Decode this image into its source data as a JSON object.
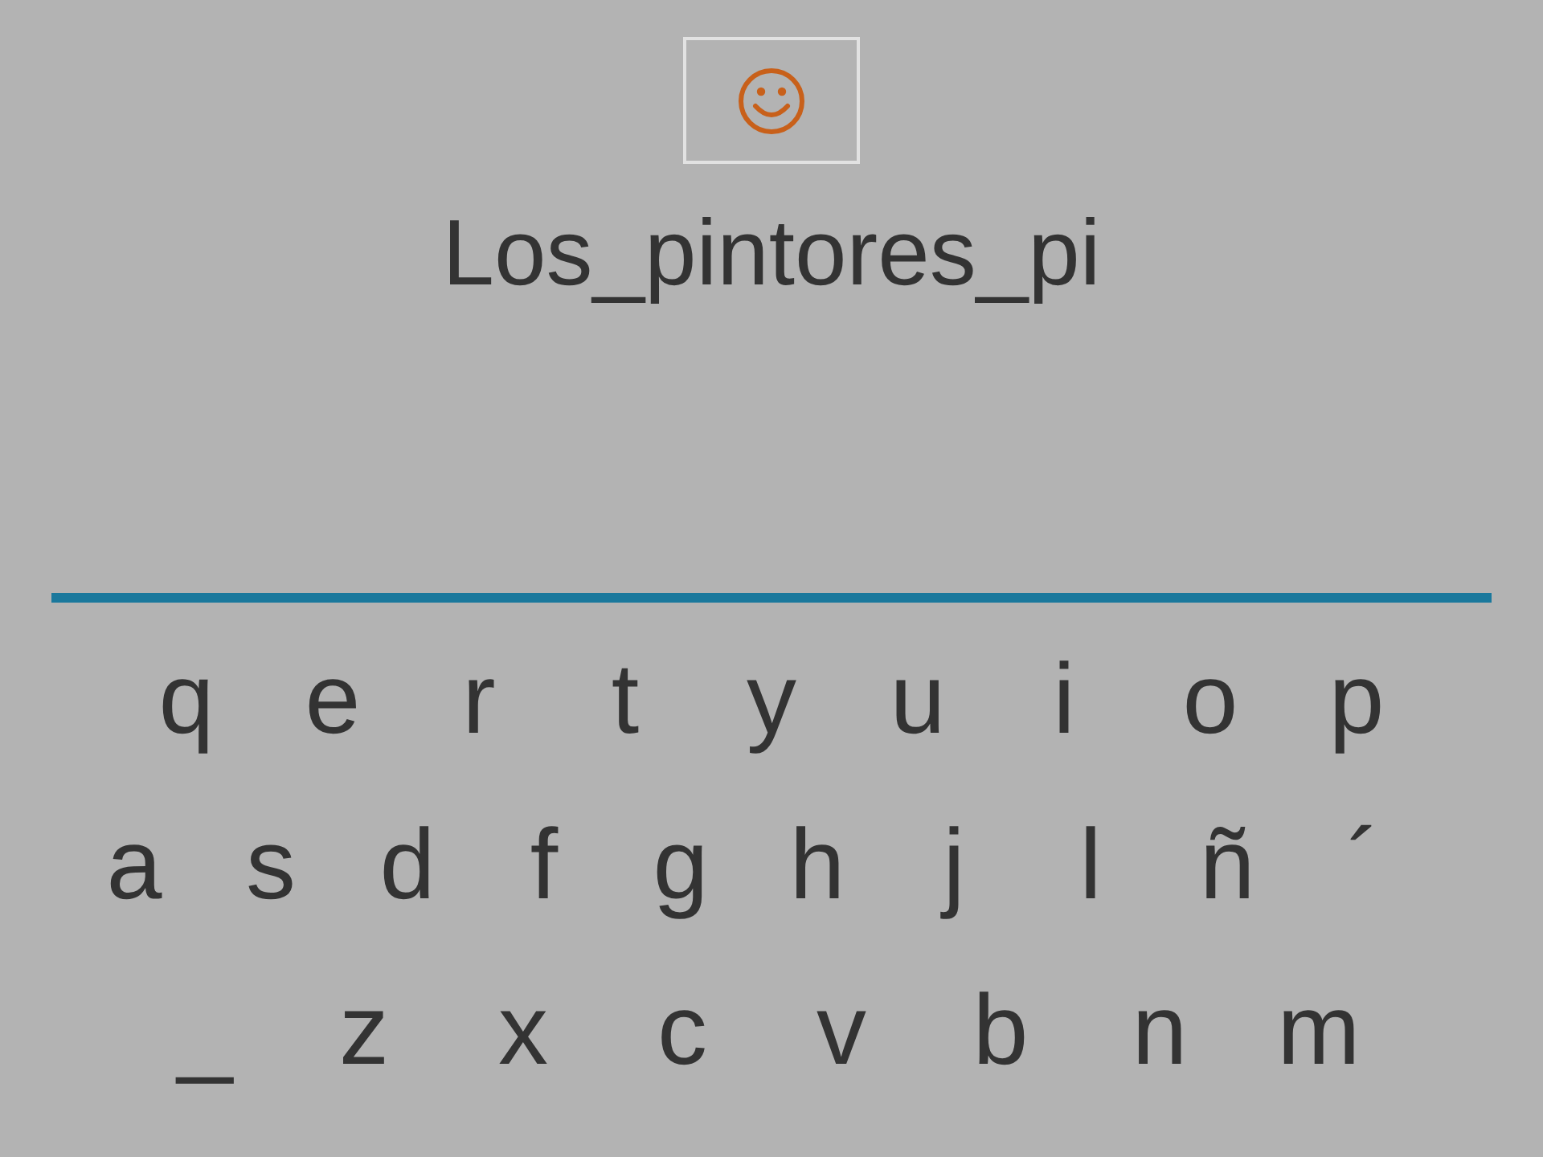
{
  "word": "Los_pintores_pi",
  "keyboard": {
    "rows": [
      {
        "keys": [
          "q",
          "e",
          "r",
          "t",
          "y",
          "u",
          "i",
          "o",
          "p"
        ]
      },
      {
        "keys": [
          "a",
          "s",
          "d",
          "f",
          "g",
          "h",
          "j",
          "l",
          "ñ",
          "´"
        ]
      },
      {
        "keys": [
          "_",
          "z",
          "x",
          "c",
          "v",
          "b",
          "n",
          "m"
        ]
      }
    ]
  }
}
